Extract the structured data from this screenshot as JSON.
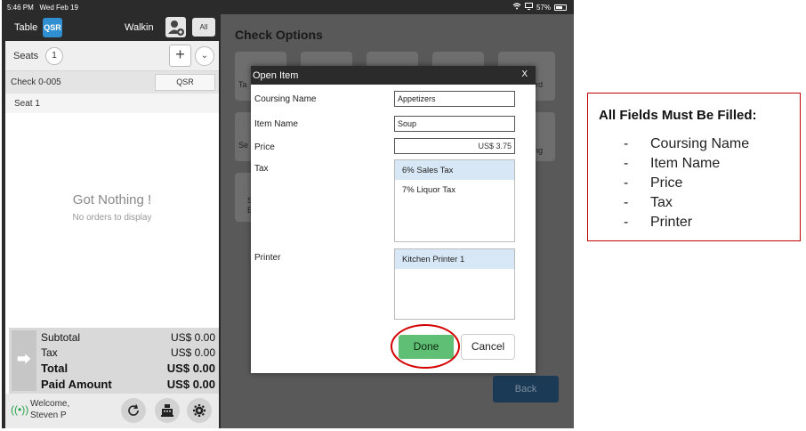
{
  "status_bar": {
    "time": "5:46 PM",
    "date": "Wed Feb 19",
    "battery": "57%"
  },
  "left_panel": {
    "table_label": "Table",
    "qsr_badge": "QSR",
    "customer": "Walkin",
    "all_button": "All",
    "seats_label": "Seats",
    "seats_count": "1",
    "add_button": "+",
    "check_label": "Check  0-005",
    "check_type_button": "QSR",
    "seat_label": "Seat 1",
    "empty_title": "Got Nothing !",
    "empty_subtitle": "No orders to display",
    "totals": {
      "subtotal_label": "Subtotal",
      "subtotal_value": "US$ 0.00",
      "tax_label": "Tax",
      "tax_value": "US$ 0.00",
      "total_label": "Total",
      "total_value": "US$ 0.00",
      "paid_label": "Paid Amount",
      "paid_value": "US$ 0.00"
    },
    "welcome_line1": "Welcome,",
    "welcome_line2": "Steven P"
  },
  "right_panel": {
    "title": "Check Options",
    "back_button": "Back",
    "partial_labels": {
      "tile1": "Ta",
      "tile2": "rd",
      "tile3": "Se",
      "tile4": "ng",
      "tile5a": "S",
      "tile5b": "E"
    }
  },
  "modal": {
    "title": "Open Item",
    "close": "X",
    "coursing_label": "Coursing Name",
    "coursing_value": "Appetizers",
    "item_label": "Item Name",
    "item_value": "Soup",
    "price_label": "Price",
    "price_value": "US$ 3.75",
    "tax_label": "Tax",
    "tax_options": [
      "6% Sales Tax",
      "7% Liquor Tax"
    ],
    "tax_selected": "6% Sales Tax",
    "printer_label": "Printer",
    "printer_options": [
      "Kitchen Printer 1"
    ],
    "printer_selected": "Kitchen Printer 1",
    "done_button": "Done",
    "cancel_button": "Cancel"
  },
  "annotation": {
    "header": "All Fields Must Be Filled:",
    "items": [
      "Coursing Name",
      "Item Name",
      "Price",
      "Tax",
      "Printer"
    ]
  },
  "colors": {
    "qsr_blue": "#2f8fd0",
    "done_green": "#5fbf74",
    "highlight_red": "#d40000",
    "back_navy": "#1b3a55"
  }
}
